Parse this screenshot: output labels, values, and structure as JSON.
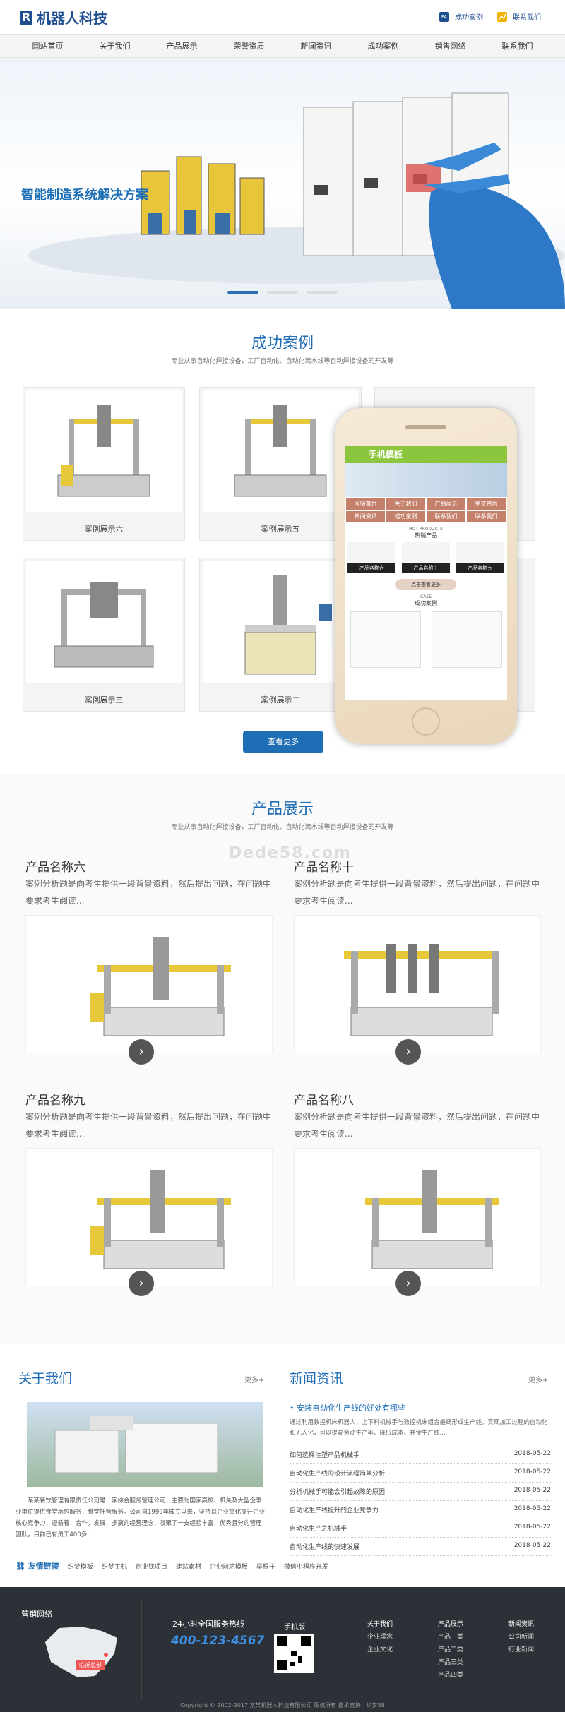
{
  "header": {
    "logo_mark": "R",
    "logo_text": "机器人科技",
    "link1_icon": "FA",
    "link1": "成功案例",
    "link2": "联系我们"
  },
  "nav": [
    "网站首页",
    "关于我们",
    "产品展示",
    "荣誉资质",
    "新闻资讯",
    "成功案例",
    "销售网络",
    "联系我们"
  ],
  "banner": {
    "headline": "智能制造系统解决方案"
  },
  "cases": {
    "title": "成功案例",
    "subtitle": "专业从事自动化焊接设备，工厂自动化、自动化流水线等自动焊接设备的开发等",
    "items": [
      "案例展示六",
      "案例展示五",
      "案例展示三",
      "案例展示二"
    ],
    "more": "查看更多"
  },
  "phone": {
    "banner_text": "手机模板",
    "menu": [
      "网站首页",
      "关于我们",
      "产品展示",
      "荣誉资质",
      "新闻资讯",
      "成功案例",
      "联系我们",
      "联系我们"
    ],
    "hot_en": "HOT PRODUCTS",
    "hot_cn": "热销产品",
    "prod": [
      "产品名称六",
      "产品名称十",
      "产品名称九"
    ],
    "more": "点击查看更多",
    "case_en": "CASE",
    "case_cn": "成功案例"
  },
  "products": {
    "title": "产品展示",
    "subtitle": "专业从事自动化焊接设备，工厂自动化、自动化流水线等自动焊接设备的开发等",
    "watermark": "Dede58.com",
    "items": [
      {
        "name": "产品名称六",
        "desc": "案例分析题是向考生提供一段背景资料，然后提出问题，在问题中要求考生阅读..."
      },
      {
        "name": "产品名称十",
        "desc": "案例分析题是向考生提供一段背景资料，然后提出问题，在问题中要求考生阅读..."
      },
      {
        "name": "产品名称九",
        "desc": "案例分析题是向考生提供一段背景资料，然后提出问题，在问题中要求考生阅读..."
      },
      {
        "name": "产品名称八",
        "desc": "案例分析题是向考生提供一段背景资料，然后提出问题，在问题中要求考生阅读..."
      }
    ]
  },
  "about": {
    "title": "关于我们",
    "more": "更多+",
    "text": "某某餐饮管理有限责任公司是一家综合服务管理公司，主要为国家高校、机关及大型企事业单位提供食堂承包服务，食堂托管服务。公司自1999年成立以来，坚持以企业文化提升企业核心竞争力，遵循着：合作，发展，多赢的经营理念，凝聚了一支经验丰富、优秀且分的管理团队，目前已有员工400多..."
  },
  "news": {
    "title": "新闻资讯",
    "more": "更多+",
    "headline": "安装自动化生产线的好处有哪些",
    "summary": "通过利用数控机床机器人，上下料机械手与数控机床组合最终形成生产线，实现加工过程的自动化和无人化，可以提高劳动生产率、降低成本、并使生产线...",
    "items": [
      {
        "title": "如何选择注塑产品机械手",
        "date": "2018-05-22"
      },
      {
        "title": "自动化生产线的设计流程简单分析",
        "date": "2018-05-22"
      },
      {
        "title": "分析机械手可能会引起故障的原因",
        "date": "2018-05-22"
      },
      {
        "title": "自动化生产线提升的企业竞争力",
        "date": "2018-05-22"
      },
      {
        "title": "自动化生产之机械手",
        "date": "2018-05-22"
      },
      {
        "title": "自动化生产线的快速发展",
        "date": "2018-05-22"
      }
    ]
  },
  "friend_links": {
    "label": "友情链接",
    "items": [
      "织梦模板",
      "织梦主机",
      "创业找项目",
      "建站素材",
      "企业网站模板",
      "草根子",
      "微信小程序开发"
    ]
  },
  "footer": {
    "sales": "营销网络",
    "map_tag": "临沂总部",
    "hotline_label": "24小时全国服务热线",
    "hotline": "400-123-4567",
    "mobile_label": "手机版",
    "cols": [
      {
        "title": "关于我们",
        "items": [
          "企业理念",
          "企业文化"
        ]
      },
      {
        "title": "产品展示",
        "items": [
          "产品一类",
          "产品二类",
          "产品三类",
          "产品四类"
        ]
      },
      {
        "title": "新闻资讯",
        "items": [
          "公司新闻",
          "行业新闻"
        ]
      }
    ],
    "copyright": "Copyright © 2002-2017 某某机器人科技有限公司 版权所有 技术支持：织梦58"
  }
}
